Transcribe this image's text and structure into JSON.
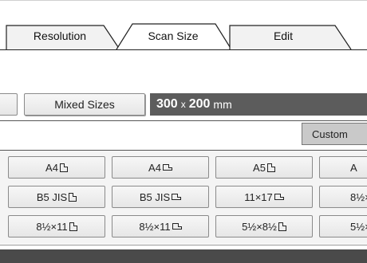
{
  "tabs": [
    {
      "label": "Resolution"
    },
    {
      "label": "Scan Size"
    },
    {
      "label": "Edit"
    }
  ],
  "mixed_sizes_label": "Mixed Sizes",
  "size_display": {
    "width": "300",
    "x": "x",
    "height": "200",
    "unit": "mm"
  },
  "custom_label": "Custom",
  "paper_rows": [
    [
      "A4",
      "A4",
      "A5",
      "A"
    ],
    [
      "B5 JIS",
      "B5 JIS",
      "11×17",
      "8½×"
    ],
    [
      "8½×11",
      "8½×11",
      "5½×8½",
      "5½×"
    ]
  ],
  "orientations": [
    [
      "portrait",
      "landscape",
      "portrait",
      ""
    ],
    [
      "portrait",
      "landscape",
      "landscape",
      ""
    ],
    [
      "portrait",
      "landscape",
      "portrait",
      ""
    ]
  ]
}
